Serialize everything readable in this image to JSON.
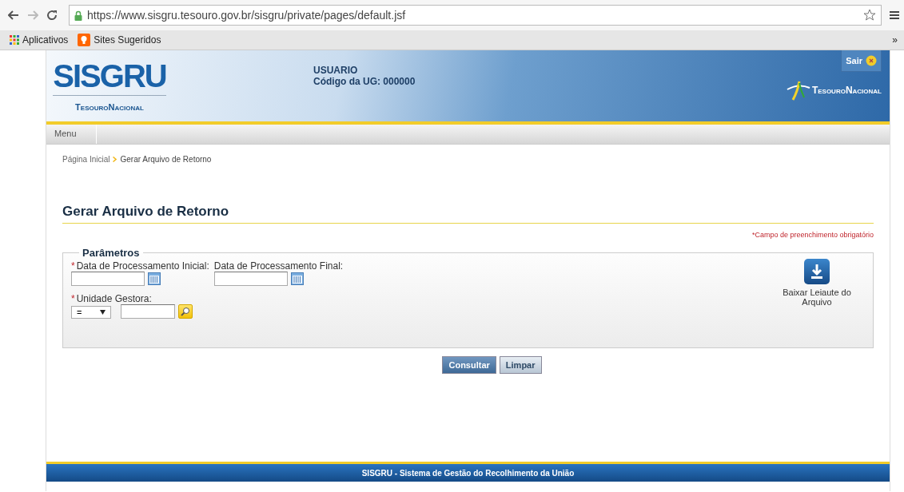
{
  "browser": {
    "url": "https://www.sisgru.tesouro.gov.br/sisgru/private/pages/default.jsf",
    "bookmarks": [
      {
        "label": "Aplicativos",
        "kind": "apps"
      },
      {
        "label": "Sites Sugeridos",
        "kind": "bulb"
      }
    ],
    "overflow": "»"
  },
  "header": {
    "logo": "SISGRU",
    "logo_sub": "TesouroNacional",
    "user": "USUARIO",
    "ug": "Código da UG: 000000",
    "logout": "Sair",
    "brand": "TesouroNacional"
  },
  "menu": [
    "Menu"
  ],
  "breadcrumb": [
    {
      "label": "Página Inicial"
    },
    {
      "label": "Gerar Arquivo de Retorno"
    }
  ],
  "page_title": "Gerar Arquivo de Retorno",
  "required_note": "*Campo de preenchimento obrigatório",
  "parameters": {
    "legend": "Parâmetros",
    "required_mark": "*",
    "date_fields": [
      {
        "label": "Data de Processamento Inicial:",
        "required": true
      },
      {
        "label": "Data de Processamento Final:",
        "required": false
      }
    ],
    "unit": {
      "label": "Unidade Gestora:",
      "required": true,
      "operator": "="
    },
    "download": "Baixar Leiaute do Arquivo"
  },
  "buttons": [
    {
      "label": "Consultar",
      "kind": "primary"
    },
    {
      "label": "Limpar",
      "kind": "secondary"
    }
  ],
  "footer": "SISGRU - Sistema de Gestão do Recolhimento da União"
}
